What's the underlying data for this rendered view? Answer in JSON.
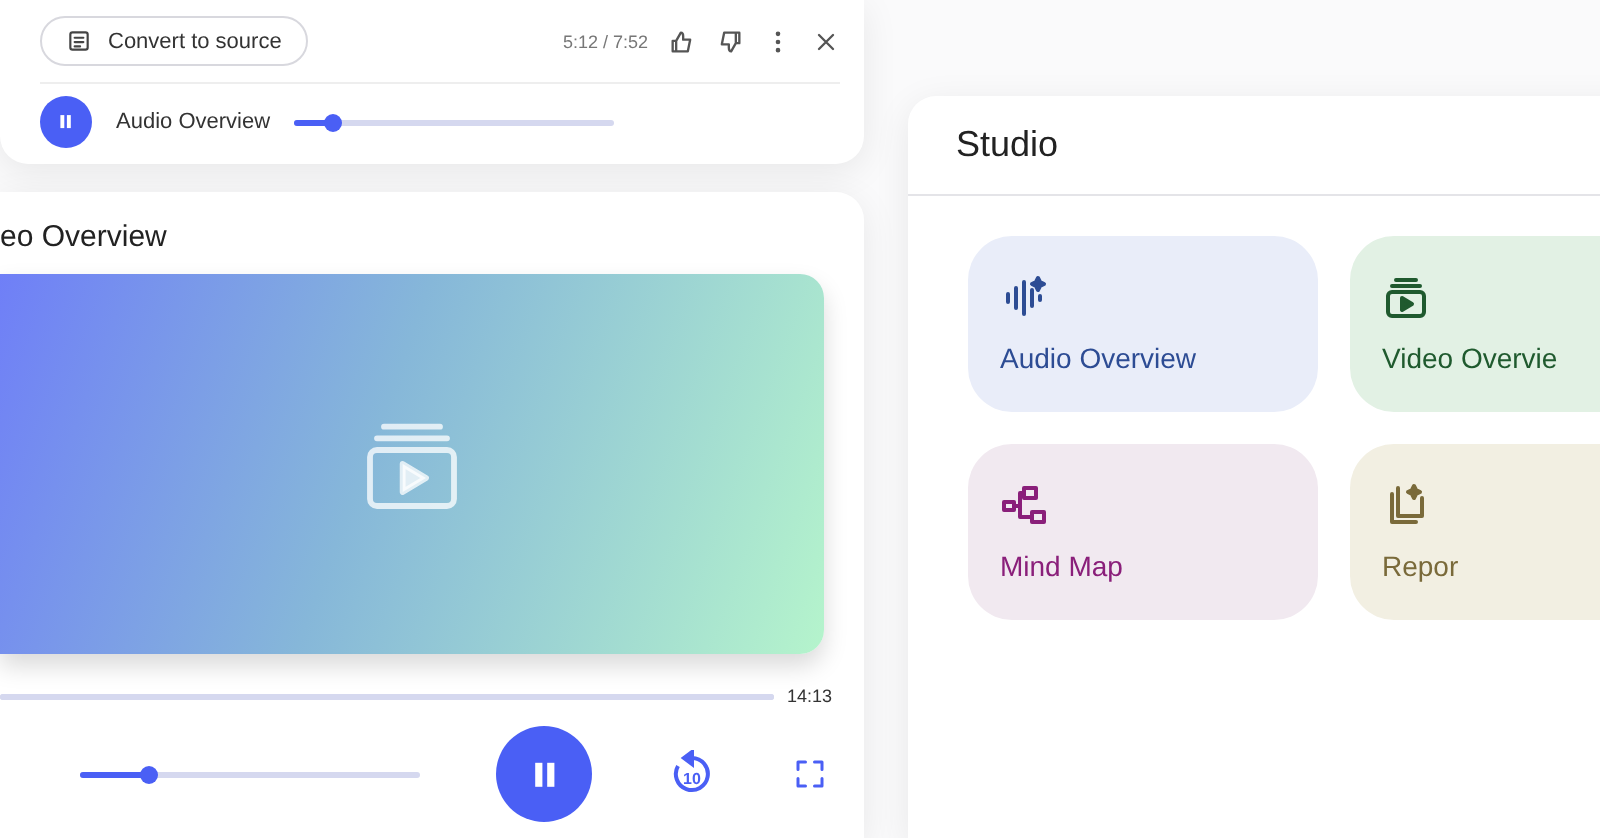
{
  "audio_player": {
    "convert_button": "Convert to source",
    "time": "5:12 / 7:52",
    "title": "Audio Overview",
    "progress": {
      "level": 0.12
    },
    "playing": true
  },
  "video_player": {
    "title": "eo Overview",
    "duration": "14:13",
    "progress": {
      "level": 0.2
    },
    "playing": true,
    "rewind_label": "10"
  },
  "studio": {
    "title": "Studio",
    "tiles": [
      {
        "kind": "audio",
        "label": "Audio Overview",
        "color": "#e9edf9"
      },
      {
        "kind": "video",
        "label": "Video Overvie",
        "color": "#e2f1e4"
      },
      {
        "kind": "mindmap",
        "label": "Mind Map",
        "color": "#f1e9f0"
      },
      {
        "kind": "report",
        "label": "Repor",
        "color": "#f2efe2"
      }
    ]
  }
}
